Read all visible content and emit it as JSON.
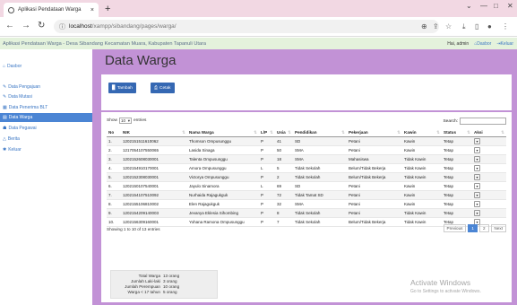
{
  "browser": {
    "tab_title": "Aplikasi Pendataan Warga",
    "tab_close": "×",
    "new_tab": "+",
    "url_host": "localhost",
    "url_path": "/xampp/sibandang/pages/warga/",
    "icons": [
      "back-icon",
      "forward-icon",
      "reload-icon",
      "info-icon",
      "zoom-icon",
      "share-icon",
      "star-icon",
      "download-icon",
      "extension-icon",
      "profile-icon",
      "menu-icon"
    ]
  },
  "app": {
    "title": "Aplikasi Pendataan Warga - Desa Sibandang Kecamatan Muara, Kabupaten Tapanuli Utara",
    "user": "Hai, admin",
    "dashboard_link": "Dasbor",
    "logout_link": "Keluar"
  },
  "sidebar": {
    "items": [
      {
        "label": "Dasbor"
      },
      {
        "label": "Data Pengajuan"
      },
      {
        "label": "Data Mutasi"
      },
      {
        "label": "Data Penerima BLT"
      },
      {
        "label": "Data Warga"
      },
      {
        "label": "Data Pegawai"
      },
      {
        "label": "Berita"
      },
      {
        "label": "Keluar"
      }
    ],
    "active_index": 4
  },
  "main": {
    "page_title": "Data Warga",
    "add_button": "Tambah",
    "print_button": "Cetak",
    "show_label": "Show",
    "show_value": "10",
    "entries_label": "entries",
    "search_label": "Search:",
    "columns": [
      "No",
      "NIK",
      "Nama Warga",
      "L/P",
      "Usia",
      "Pendidikan",
      "Pekerjaan",
      "Kawin",
      "Status",
      "Aksi"
    ],
    "rows": [
      [
        "1.",
        "1202151511610062",
        "Thomson Ompusunggu",
        "P",
        "41",
        "SD",
        "Petani",
        "Kawin",
        "Tetap"
      ],
      [
        "2.",
        "1217054107550065",
        "Lasida Sinaga",
        "P",
        "50",
        "SMA",
        "Petani",
        "Kawin",
        "Tetap"
      ],
      [
        "3.",
        "1202152608030001",
        "Talenta Ompusunggu",
        "P",
        "18",
        "SMA",
        "Mahasiswa",
        "Tidak Kawin",
        "Tetap"
      ],
      [
        "4.",
        "1202154910170001",
        "Amora Ompusunggu",
        "L",
        "5",
        "Tidak Sekolah",
        "Belum/Tidak Bekerja",
        "Tidak Kawin",
        "Tetap"
      ],
      [
        "5.",
        "1202152308030001",
        "Victorya Ompusunggu",
        "P",
        "2",
        "Tidak Sekolah",
        "Belum/Tidak Bekerja",
        "Tidak Kawin",
        "Tetap"
      ],
      [
        "6.",
        "1202150107540001",
        "Jayulo Sinamora",
        "L",
        "69",
        "SD",
        "Petani",
        "Kawin",
        "Tetap"
      ],
      [
        "7.",
        "1202154107510092",
        "Nurhaida Rajagukguk",
        "P",
        "72",
        "Tidak Tamat SD",
        "Petani",
        "Kawin",
        "Tetap"
      ],
      [
        "8.",
        "1202155106810002",
        "Elen Rajagukguk",
        "P",
        "32",
        "SMA",
        "Petani",
        "Kawin",
        "Tetap"
      ],
      [
        "9.",
        "1202154209140003",
        "Jevanya Eklesia Sihombing",
        "P",
        "8",
        "Tidak Sekolah",
        "Petani",
        "Tidak Kawin",
        "Tetap"
      ],
      [
        "10.",
        "1202156309160001",
        "Yohana Ramona Ompusunggu",
        "P",
        "7",
        "Tidak Sekolah",
        "Belum/Tidak Bekerja",
        "Tidak Kawin",
        "Tetap"
      ]
    ],
    "info": "Showing 1 to 10 of 13 entries",
    "pager": {
      "previous": "Previous",
      "pages": [
        "1",
        "2"
      ],
      "current": "1",
      "next": "Next"
    },
    "summary": [
      {
        "label": "Total Warga",
        "value": "13 orang"
      },
      {
        "label": "Jumlah Laki-laki",
        "value": "3 orang"
      },
      {
        "label": "Jumlah Perempuan",
        "value": "10 orang"
      },
      {
        "label": "Warga < 17 tahun",
        "value": "5 orang"
      }
    ]
  },
  "watermark": {
    "title": "Activate Windows",
    "subtitle": "Go to Settings to activate Windows."
  },
  "colors": {
    "main_bg": "#c292d6",
    "sidebar_active": "#4b85d4",
    "header_bg": "#e4f2dc",
    "tabbar_bg": "#f2d8e3",
    "button_bg": "#3568b3"
  }
}
